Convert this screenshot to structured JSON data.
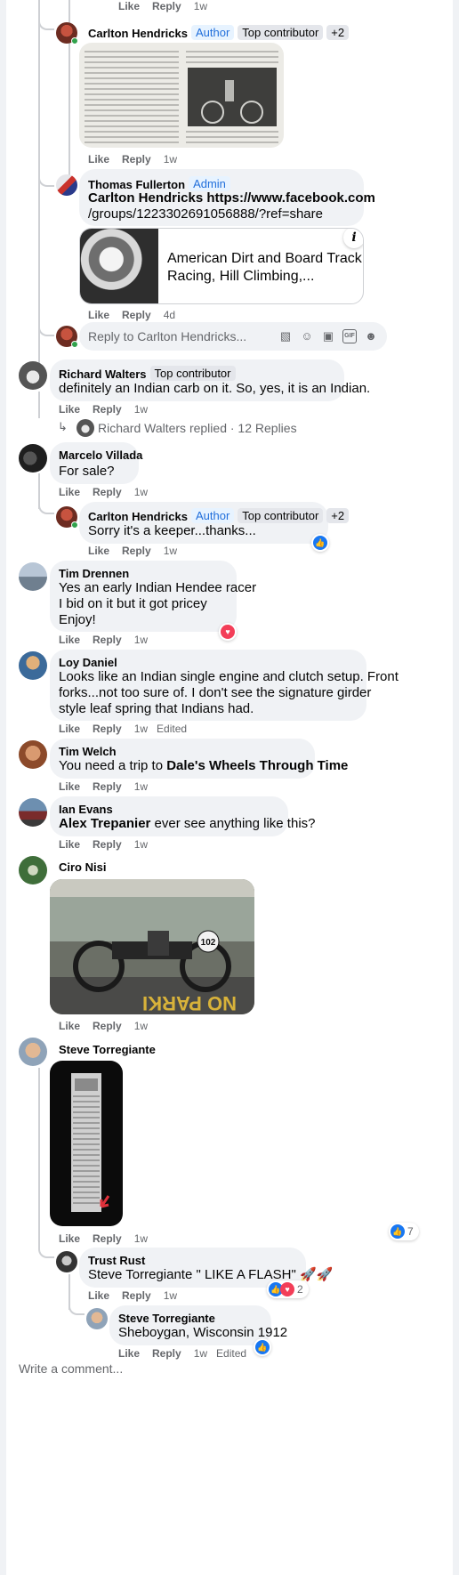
{
  "colors": {
    "accent": "#216fdb",
    "text": "#050505",
    "muted": "#65676b",
    "bubble": "#f0f2f5",
    "like": "#1877f2",
    "love": "#f33e58"
  },
  "labels": {
    "like": "Like",
    "reply": "Reply",
    "edited": "Edited"
  },
  "top": {
    "time": "1w"
  },
  "c1": {
    "name": "Carlton Hendricks",
    "badges": [
      "Author",
      "Top contributor",
      "+2"
    ],
    "time": "1w"
  },
  "c2": {
    "name": "Thomas Fullerton",
    "badge": "Admin",
    "text_line1": "Carlton Hendricks https://www.facebook.com",
    "text_line2": "/groups/1223302691056888/?ref=share",
    "link_title_line1": "American Dirt and Board Track",
    "link_title_line2": "Racing, Hill Climbing,...",
    "info_icon": "info-icon",
    "time": "4d"
  },
  "reply_box": {
    "placeholder": "Reply to Carlton Hendricks...",
    "icons": [
      "sticker-icon",
      "emoji-icon",
      "camera-icon",
      "gif-icon",
      "avatar-sticker-icon"
    ]
  },
  "c3": {
    "name": "Richard Walters",
    "badge": "Top contributor",
    "text": "definitely an Indian carb on it. So, yes, it is an Indian.",
    "time": "1w",
    "replies_summary": "Richard Walters replied · 12 Replies"
  },
  "c4": {
    "name": "Marcelo Villada",
    "text": "For sale?",
    "time": "1w"
  },
  "c5": {
    "name": "Carlton Hendricks",
    "badges": [
      "Author",
      "Top contributor",
      "+2"
    ],
    "text": "Sorry it's a keeper...thanks...",
    "time": "1w"
  },
  "c6": {
    "name": "Tim Drennen",
    "lines": [
      "Yes an early Indian Hendee racer",
      "I bid on it but it got pricey",
      "Enjoy!"
    ],
    "time": "1w"
  },
  "c7": {
    "name": "Loy Daniel",
    "lines": [
      "Looks like an Indian single engine and clutch setup. Front",
      "forks...not too sure of. I don't see the signature girder",
      "style leaf spring that Indians had."
    ],
    "time": "1w"
  },
  "c8": {
    "name": "Tim Welch",
    "text": "You need a trip to ",
    "mention": "Dale's Wheels Through Time",
    "time": "1w"
  },
  "c9": {
    "name": "Ian Evans",
    "mention": "Alex Trepanier",
    "text": " ever see anything like this?",
    "time": "1w"
  },
  "c10": {
    "name": "Ciro Nisi",
    "time": "1w",
    "photo_plate_number": "102"
  },
  "c11": {
    "name": "Steve Torregiante",
    "time": "1w",
    "reaction_count": "7"
  },
  "c12": {
    "name": "Trust Rust",
    "text": "Steve Torregiante \" LIKE A FLASH\"",
    "emoji": "🚀🚀",
    "time": "1w",
    "reaction_count": "2"
  },
  "c13": {
    "name": "Steve Torregiante",
    "text": "Sheboygan, Wisconsin 1912",
    "time": "1w"
  },
  "write_comment": "Write a comment..."
}
